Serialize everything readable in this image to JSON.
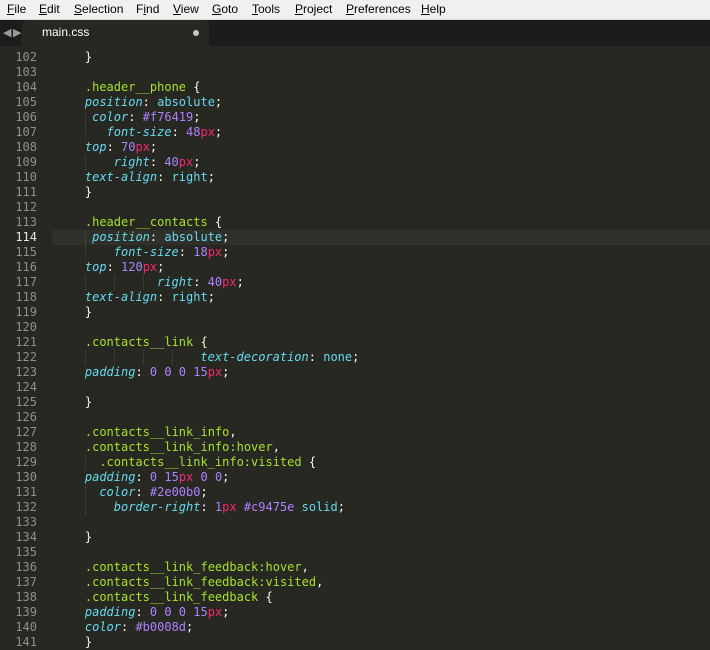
{
  "menu": [
    "File",
    "Edit",
    "Selection",
    "Find",
    "View",
    "Goto",
    "Tools",
    "Project",
    "Preferences",
    "Help"
  ],
  "menu_mnemonic_index": [
    0,
    0,
    0,
    1,
    0,
    0,
    0,
    0,
    0,
    0
  ],
  "tab": {
    "filename": "main.css"
  },
  "editor": {
    "current_line": "114",
    "lines": [
      {
        "n": "102",
        "indent": 4,
        "t": [
          [
            "}",
            "pun"
          ]
        ]
      },
      {
        "n": "103",
        "indent": 0,
        "t": []
      },
      {
        "n": "104",
        "indent": 4,
        "t": [
          [
            ".header__phone",
            "sel"
          ],
          [
            " {",
            "pun"
          ]
        ]
      },
      {
        "n": "105",
        "indent": 4,
        "t": [
          [
            "position",
            "prop"
          ],
          [
            ": ",
            "pun"
          ],
          [
            "absolute",
            "val"
          ],
          [
            ";",
            "pun"
          ]
        ]
      },
      {
        "n": "106",
        "indent": 5,
        "t": [
          [
            "color",
            "prop"
          ],
          [
            ": ",
            "pun"
          ],
          [
            "#f76419",
            "num"
          ],
          [
            ";",
            "pun"
          ]
        ]
      },
      {
        "n": "107",
        "indent": 7,
        "t": [
          [
            "font-size",
            "prop"
          ],
          [
            ": ",
            "pun"
          ],
          [
            "48",
            "num"
          ],
          [
            "px",
            "unit"
          ],
          [
            ";",
            "pun"
          ]
        ]
      },
      {
        "n": "108",
        "indent": 4,
        "t": [
          [
            "top",
            "prop"
          ],
          [
            ": ",
            "pun"
          ],
          [
            "70",
            "num"
          ],
          [
            "px",
            "unit"
          ],
          [
            ";",
            "pun"
          ]
        ]
      },
      {
        "n": "109",
        "indent": 8,
        "t": [
          [
            "right",
            "prop"
          ],
          [
            ": ",
            "pun"
          ],
          [
            "40",
            "num"
          ],
          [
            "px",
            "unit"
          ],
          [
            ";",
            "pun"
          ]
        ]
      },
      {
        "n": "110",
        "indent": 4,
        "t": [
          [
            "text-align",
            "prop"
          ],
          [
            ": ",
            "pun"
          ],
          [
            "right",
            "val"
          ],
          [
            ";",
            "pun"
          ]
        ]
      },
      {
        "n": "111",
        "indent": 4,
        "t": [
          [
            "}",
            "pun"
          ]
        ]
      },
      {
        "n": "112",
        "indent": 0,
        "t": []
      },
      {
        "n": "113",
        "indent": 4,
        "t": [
          [
            ".header__contacts",
            "sel"
          ],
          [
            " {",
            "pun"
          ]
        ]
      },
      {
        "n": "114",
        "indent": 5,
        "t": [
          [
            "position",
            "prop"
          ],
          [
            ": ",
            "pun"
          ],
          [
            "absolute",
            "val"
          ],
          [
            ";",
            "pun"
          ]
        ]
      },
      {
        "n": "115",
        "indent": 8,
        "t": [
          [
            "font-size",
            "prop"
          ],
          [
            ": ",
            "pun"
          ],
          [
            "18",
            "num"
          ],
          [
            "px",
            "unit"
          ],
          [
            ";",
            "pun"
          ]
        ]
      },
      {
        "n": "116",
        "indent": 4,
        "t": [
          [
            "top",
            "prop"
          ],
          [
            ": ",
            "pun"
          ],
          [
            "120",
            "num"
          ],
          [
            "px",
            "unit"
          ],
          [
            ";",
            "pun"
          ]
        ]
      },
      {
        "n": "117",
        "indent": 14,
        "t": [
          [
            "right",
            "prop"
          ],
          [
            ": ",
            "pun"
          ],
          [
            "40",
            "num"
          ],
          [
            "px",
            "unit"
          ],
          [
            ";",
            "pun"
          ]
        ]
      },
      {
        "n": "118",
        "indent": 4,
        "t": [
          [
            "text-align",
            "prop"
          ],
          [
            ": ",
            "pun"
          ],
          [
            "right",
            "val"
          ],
          [
            ";",
            "pun"
          ]
        ]
      },
      {
        "n": "119",
        "indent": 4,
        "t": [
          [
            "}",
            "pun"
          ]
        ]
      },
      {
        "n": "120",
        "indent": 0,
        "t": []
      },
      {
        "n": "121",
        "indent": 4,
        "t": [
          [
            ".contacts__link",
            "sel"
          ],
          [
            " {",
            "pun"
          ]
        ]
      },
      {
        "n": "122",
        "indent": 20,
        "t": [
          [
            "text-decoration",
            "prop"
          ],
          [
            ": ",
            "pun"
          ],
          [
            "none",
            "val"
          ],
          [
            ";",
            "pun"
          ]
        ]
      },
      {
        "n": "123",
        "indent": 4,
        "t": [
          [
            "padding",
            "prop"
          ],
          [
            ": ",
            "pun"
          ],
          [
            "0 0 0 ",
            "num"
          ],
          [
            "15",
            "num"
          ],
          [
            "px",
            "unit"
          ],
          [
            ";",
            "pun"
          ]
        ]
      },
      {
        "n": "124",
        "indent": 0,
        "t": []
      },
      {
        "n": "125",
        "indent": 4,
        "t": [
          [
            "}",
            "pun"
          ]
        ]
      },
      {
        "n": "126",
        "indent": 0,
        "t": []
      },
      {
        "n": "127",
        "indent": 4,
        "t": [
          [
            ".contacts__link_info",
            "sel"
          ],
          [
            ",",
            "pun"
          ]
        ]
      },
      {
        "n": "128",
        "indent": 4,
        "t": [
          [
            ".contacts__link_info:hover",
            "sel"
          ],
          [
            ",",
            "pun"
          ]
        ]
      },
      {
        "n": "129",
        "indent": 6,
        "t": [
          [
            ".contacts__link_info:visited",
            "sel"
          ],
          [
            " {",
            "pun"
          ]
        ]
      },
      {
        "n": "130",
        "indent": 4,
        "t": [
          [
            "padding",
            "prop"
          ],
          [
            ": ",
            "pun"
          ],
          [
            "0 ",
            "num"
          ],
          [
            "15",
            "num"
          ],
          [
            "px",
            "unit"
          ],
          [
            " 0 0",
            "num"
          ],
          [
            ";",
            "pun"
          ]
        ]
      },
      {
        "n": "131",
        "indent": 6,
        "t": [
          [
            "color",
            "prop"
          ],
          [
            ": ",
            "pun"
          ],
          [
            "#2e00b0",
            "num"
          ],
          [
            ";",
            "pun"
          ]
        ]
      },
      {
        "n": "132",
        "indent": 8,
        "t": [
          [
            "border-right",
            "prop"
          ],
          [
            ": ",
            "pun"
          ],
          [
            "1",
            "num"
          ],
          [
            "px",
            "unit"
          ],
          [
            " ",
            "pun"
          ],
          [
            "#c9475e",
            "num"
          ],
          [
            " solid",
            "val"
          ],
          [
            ";",
            "pun"
          ]
        ]
      },
      {
        "n": "133",
        "indent": 0,
        "t": []
      },
      {
        "n": "134",
        "indent": 4,
        "t": [
          [
            "}",
            "pun"
          ]
        ]
      },
      {
        "n": "135",
        "indent": 0,
        "t": []
      },
      {
        "n": "136",
        "indent": 4,
        "t": [
          [
            ".contacts__link_feedback:hover",
            "sel"
          ],
          [
            ",",
            "pun"
          ]
        ]
      },
      {
        "n": "137",
        "indent": 4,
        "t": [
          [
            ".contacts__link_feedback:visited",
            "sel"
          ],
          [
            ",",
            "pun"
          ]
        ]
      },
      {
        "n": "138",
        "indent": 4,
        "t": [
          [
            ".contacts__link_feedback",
            "sel"
          ],
          [
            " {",
            "pun"
          ]
        ]
      },
      {
        "n": "139",
        "indent": 4,
        "t": [
          [
            "padding",
            "prop"
          ],
          [
            ": ",
            "pun"
          ],
          [
            "0 0 0 ",
            "num"
          ],
          [
            "15",
            "num"
          ],
          [
            "px",
            "unit"
          ],
          [
            ";",
            "pun"
          ]
        ]
      },
      {
        "n": "140",
        "indent": 4,
        "t": [
          [
            "color",
            "prop"
          ],
          [
            ": ",
            "pun"
          ],
          [
            "#b0008d",
            "num"
          ],
          [
            ";",
            "pun"
          ]
        ]
      },
      {
        "n": "141",
        "indent": 4,
        "t": [
          [
            "}",
            "pun"
          ]
        ]
      }
    ]
  }
}
